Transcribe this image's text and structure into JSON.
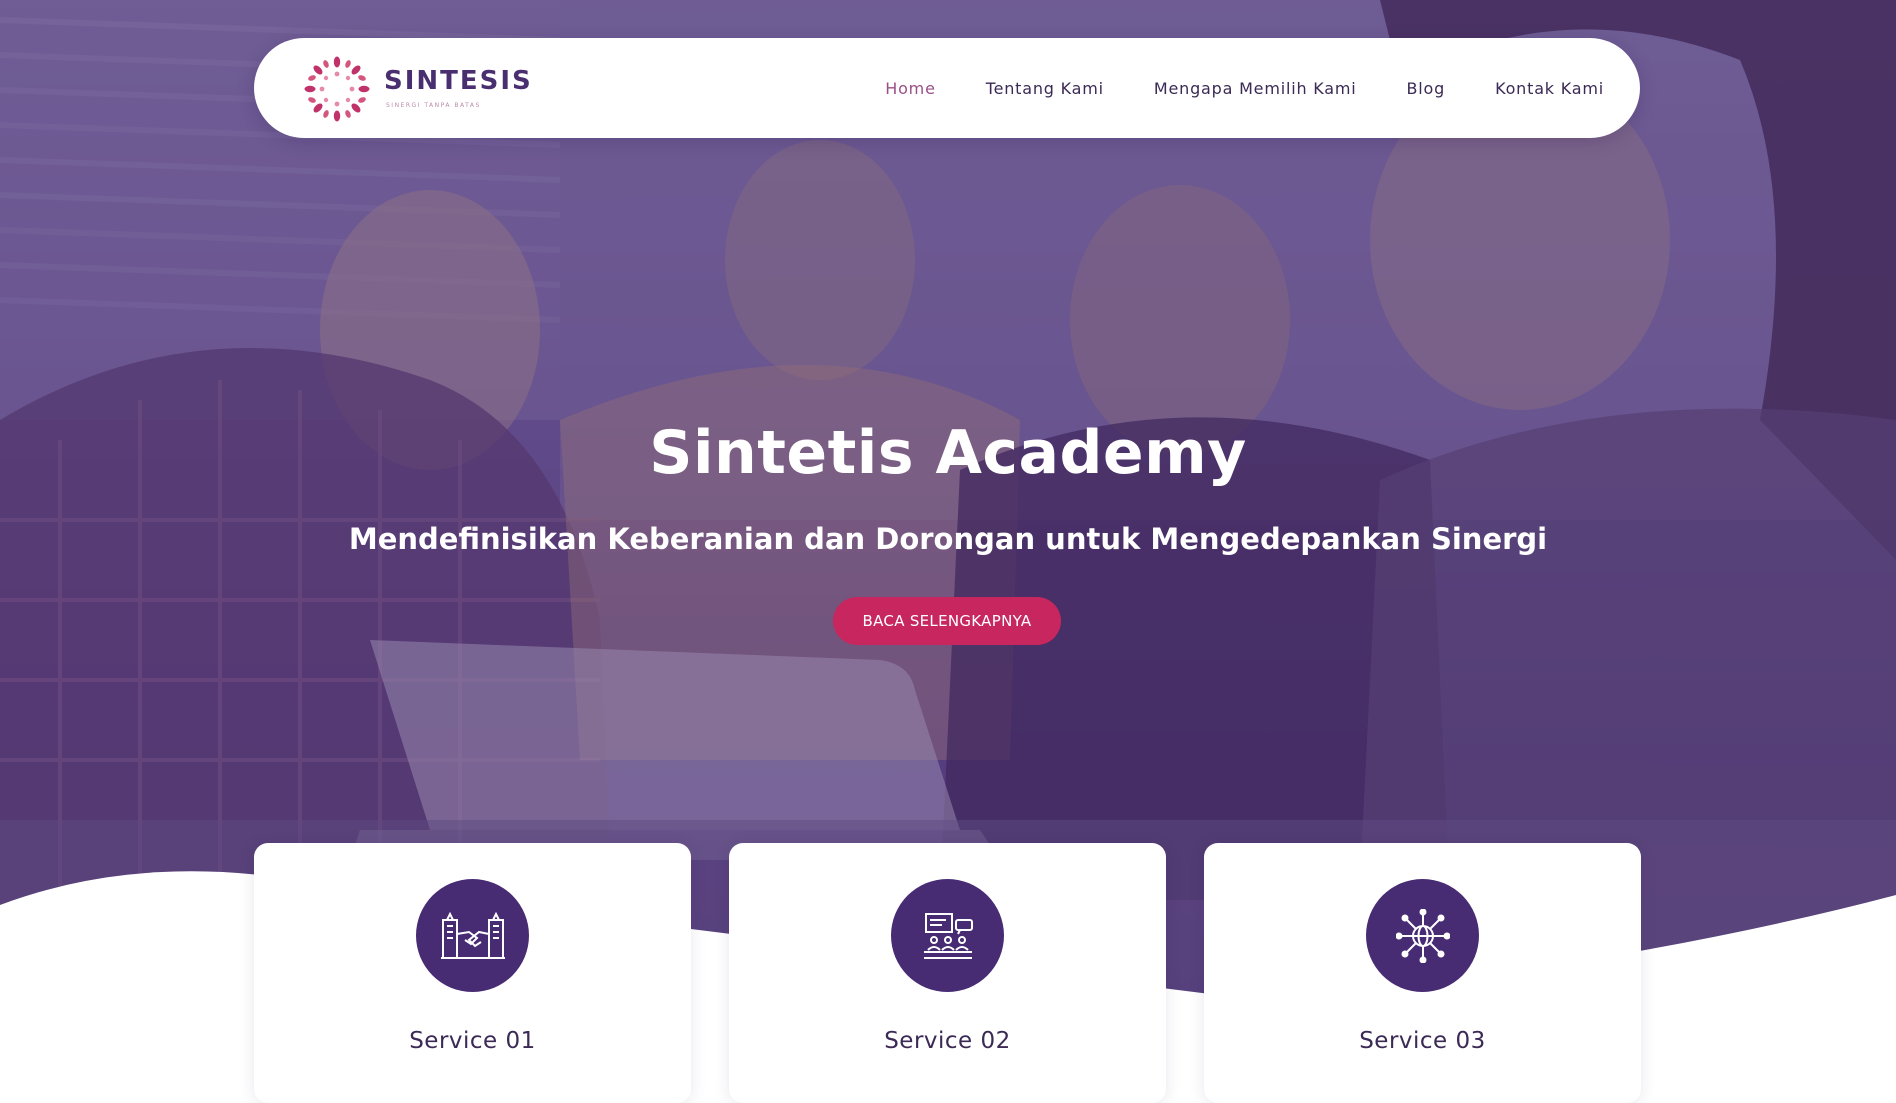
{
  "brand": {
    "name": "SINTESIS",
    "tagline": "SINERGI TANPA BATAS",
    "colors": {
      "primary": "#472b73",
      "accent": "#c8265e",
      "nav_active": "#9a4f86"
    }
  },
  "nav": {
    "items": [
      {
        "label": "Home",
        "active": true
      },
      {
        "label": "Tentang Kami",
        "active": false
      },
      {
        "label": "Mengapa Memilih Kami",
        "active": false
      },
      {
        "label": "Blog",
        "active": false
      },
      {
        "label": "Kontak Kami",
        "active": false
      }
    ]
  },
  "hero": {
    "title": "Sintetis Academy",
    "subtitle": "Mendefinisikan Keberanian dan Dorongan untuk Mengedepankan Sinergi",
    "cta_label": "BACA SELENGKAPNYA"
  },
  "services": [
    {
      "title": "Service 01",
      "icon": "handshake-buildings-icon"
    },
    {
      "title": "Service 02",
      "icon": "presentation-audience-icon"
    },
    {
      "title": "Service 03",
      "icon": "global-network-icon"
    }
  ]
}
